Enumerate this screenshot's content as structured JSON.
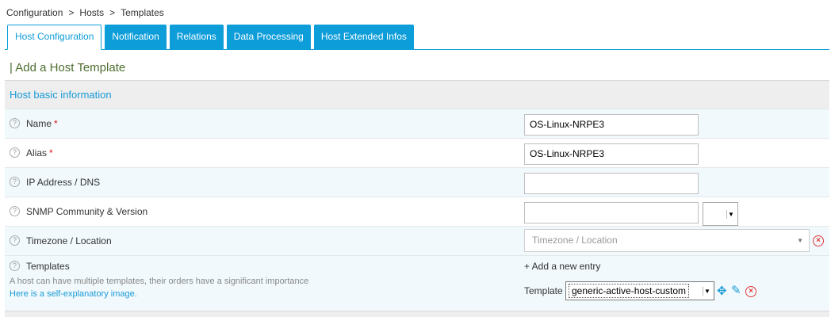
{
  "breadcrumb": [
    "Configuration",
    "Hosts",
    "Templates"
  ],
  "breadcrumb_sep": ">",
  "tabs": [
    {
      "label": "Host Configuration"
    },
    {
      "label": "Notification"
    },
    {
      "label": "Relations"
    },
    {
      "label": "Data Processing"
    },
    {
      "label": "Host Extended Infos"
    }
  ],
  "form_title": "| Add a Host Template",
  "section": {
    "title": "Host basic information"
  },
  "fields": {
    "name": {
      "label": "Name",
      "required_mark": "*",
      "value": "OS-Linux-NRPE3"
    },
    "alias": {
      "label": "Alias",
      "required_mark": "*",
      "value": "OS-Linux-NRPE3"
    },
    "ip": {
      "label": "IP Address / DNS",
      "value": ""
    },
    "snmp": {
      "label": "SNMP Community & Version",
      "value": "",
      "version": ""
    },
    "timezone": {
      "label": "Timezone / Location",
      "placeholder": "Timezone / Location"
    },
    "templates": {
      "label": "Templates",
      "hint": "A host can have multiple templates, their orders have a significant importance",
      "link": "Here is a self-explanatory image.",
      "add_entry": "+ Add a new entry",
      "template_label": "Template",
      "template_value": "generic-active-host-custom"
    }
  },
  "icons": {
    "help": "?",
    "remove": "×",
    "move": "✥",
    "edit": "✎",
    "dropdown": "▼"
  },
  "colors": {
    "accent": "#0d9dd9",
    "title": "#4c6e2e",
    "danger": "#e23a3a"
  }
}
